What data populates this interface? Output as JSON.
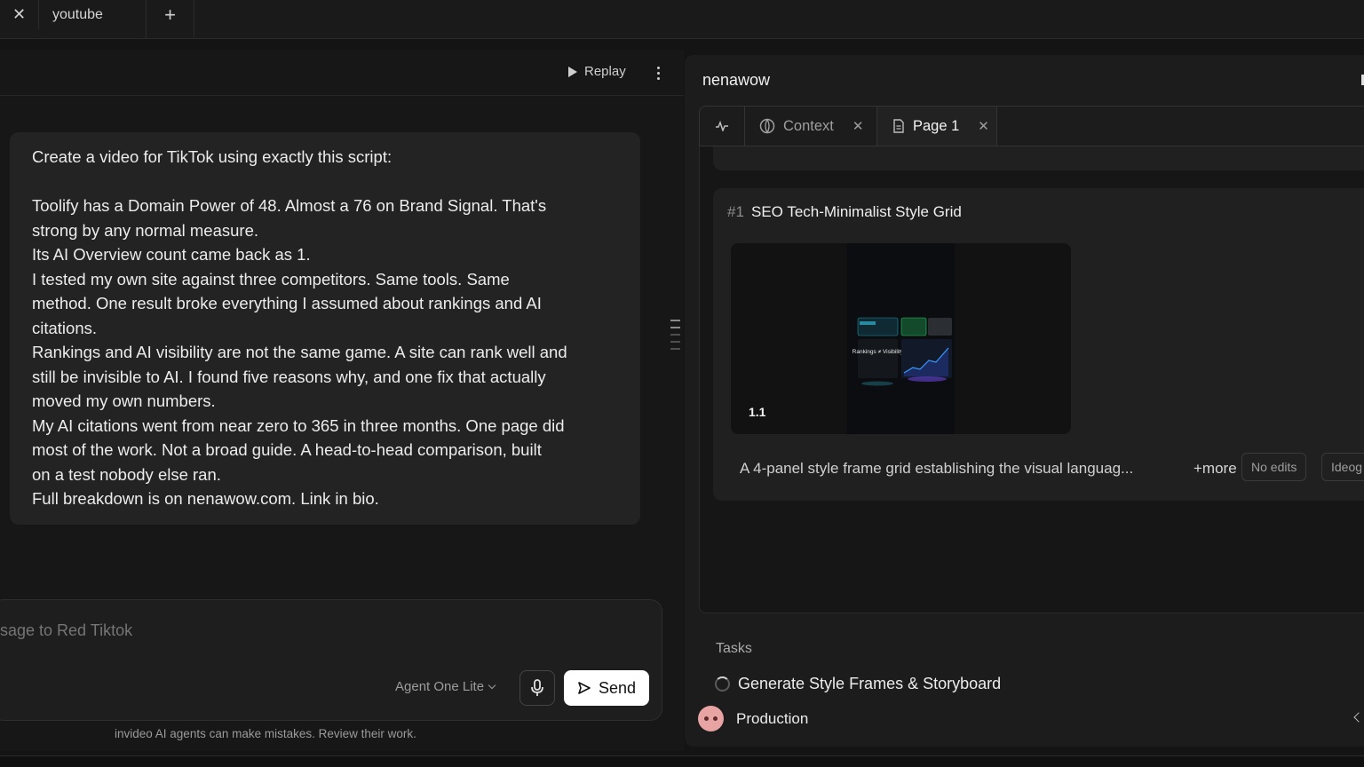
{
  "browser": {
    "tabs": [
      {
        "label": "youtube"
      }
    ],
    "close_glyph": "✕",
    "new_tab_glyph": "+"
  },
  "chat": {
    "toolbar": {
      "replay_label": "Replay"
    },
    "message": {
      "lines": [
        "Create a video for TikTok using exactly this script:",
        "",
        "Toolify has a Domain Power of 48. Almost a 76 on Brand Signal. That's",
        "strong by any normal measure.",
        "Its AI Overview count came back as 1.",
        "I tested my own site against three competitors. Same tools. Same",
        "method. One result broke everything I assumed about rankings and AI",
        "citations.",
        "Rankings and AI visibility are not the same game. A site can rank well and",
        "still be invisible to AI. I found five reasons why, and one fix that actually",
        "moved my own numbers.",
        "My AI citations went from near zero to 365 in three months. One page did",
        "most of the work. Not a broad guide. A head-to-head comparison, built",
        "on a test nobody else ran.",
        "Full breakdown is on nenawow.com. Link in bio."
      ]
    },
    "composer": {
      "placeholder": "ssage to Red Tiktok",
      "model": "Agent One Lite",
      "send_label": "Send"
    },
    "disclaimer": "invideo AI agents can make mistakes. Review their work."
  },
  "panel": {
    "project_title": "nenawow",
    "tabs": [
      {
        "label": "",
        "icon": "activity-icon"
      },
      {
        "label": "Context",
        "icon": "context-icon"
      },
      {
        "label": "Page 1",
        "icon": "page-icon",
        "active": true
      }
    ],
    "card": {
      "number": "#1",
      "title": "SEO Tech-Minimalist Style Grid",
      "thumb_label": "1.1",
      "thumb_text": "Rankings ≠ Visibility",
      "description": "A 4-panel style frame grid establishing the visual languag...",
      "more_label": "+more",
      "badges": [
        "No edits",
        "Ideog"
      ]
    },
    "tasks": {
      "heading": "Tasks",
      "items": [
        {
          "label": "Generate Style Frames & Storyboard",
          "status": "in-progress"
        }
      ]
    },
    "production_label": "Production"
  },
  "colors": {
    "background": "#141414",
    "panel": "#1c1c1c",
    "message_bubble": "#232323",
    "send_button": "#ffffff",
    "avatar": "#e8a3a3"
  }
}
